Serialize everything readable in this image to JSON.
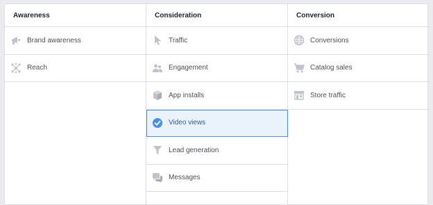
{
  "colors": {
    "accent": "#4a90e2",
    "icon_gray": "#bec2c9",
    "selected_bg": "#eaf3fb"
  },
  "columns": [
    {
      "title": "Awareness",
      "items": [
        {
          "label": "Brand awareness",
          "icon": "megaphone-icon"
        },
        {
          "label": "Reach",
          "icon": "reach-icon"
        }
      ]
    },
    {
      "title": "Consideration",
      "items": [
        {
          "label": "Traffic",
          "icon": "cursor-icon"
        },
        {
          "label": "Engagement",
          "icon": "people-icon"
        },
        {
          "label": "App installs",
          "icon": "cube-icon"
        },
        {
          "label": "Video views",
          "icon": "check-circle-icon",
          "selected": true
        },
        {
          "label": "Lead generation",
          "icon": "funnel-icon"
        },
        {
          "label": "Messages",
          "icon": "chat-bubbles-icon"
        }
      ]
    },
    {
      "title": "Conversion",
      "items": [
        {
          "label": "Conversions",
          "icon": "globe-icon"
        },
        {
          "label": "Catalog sales",
          "icon": "cart-icon"
        },
        {
          "label": "Store traffic",
          "icon": "store-icon"
        }
      ]
    }
  ]
}
